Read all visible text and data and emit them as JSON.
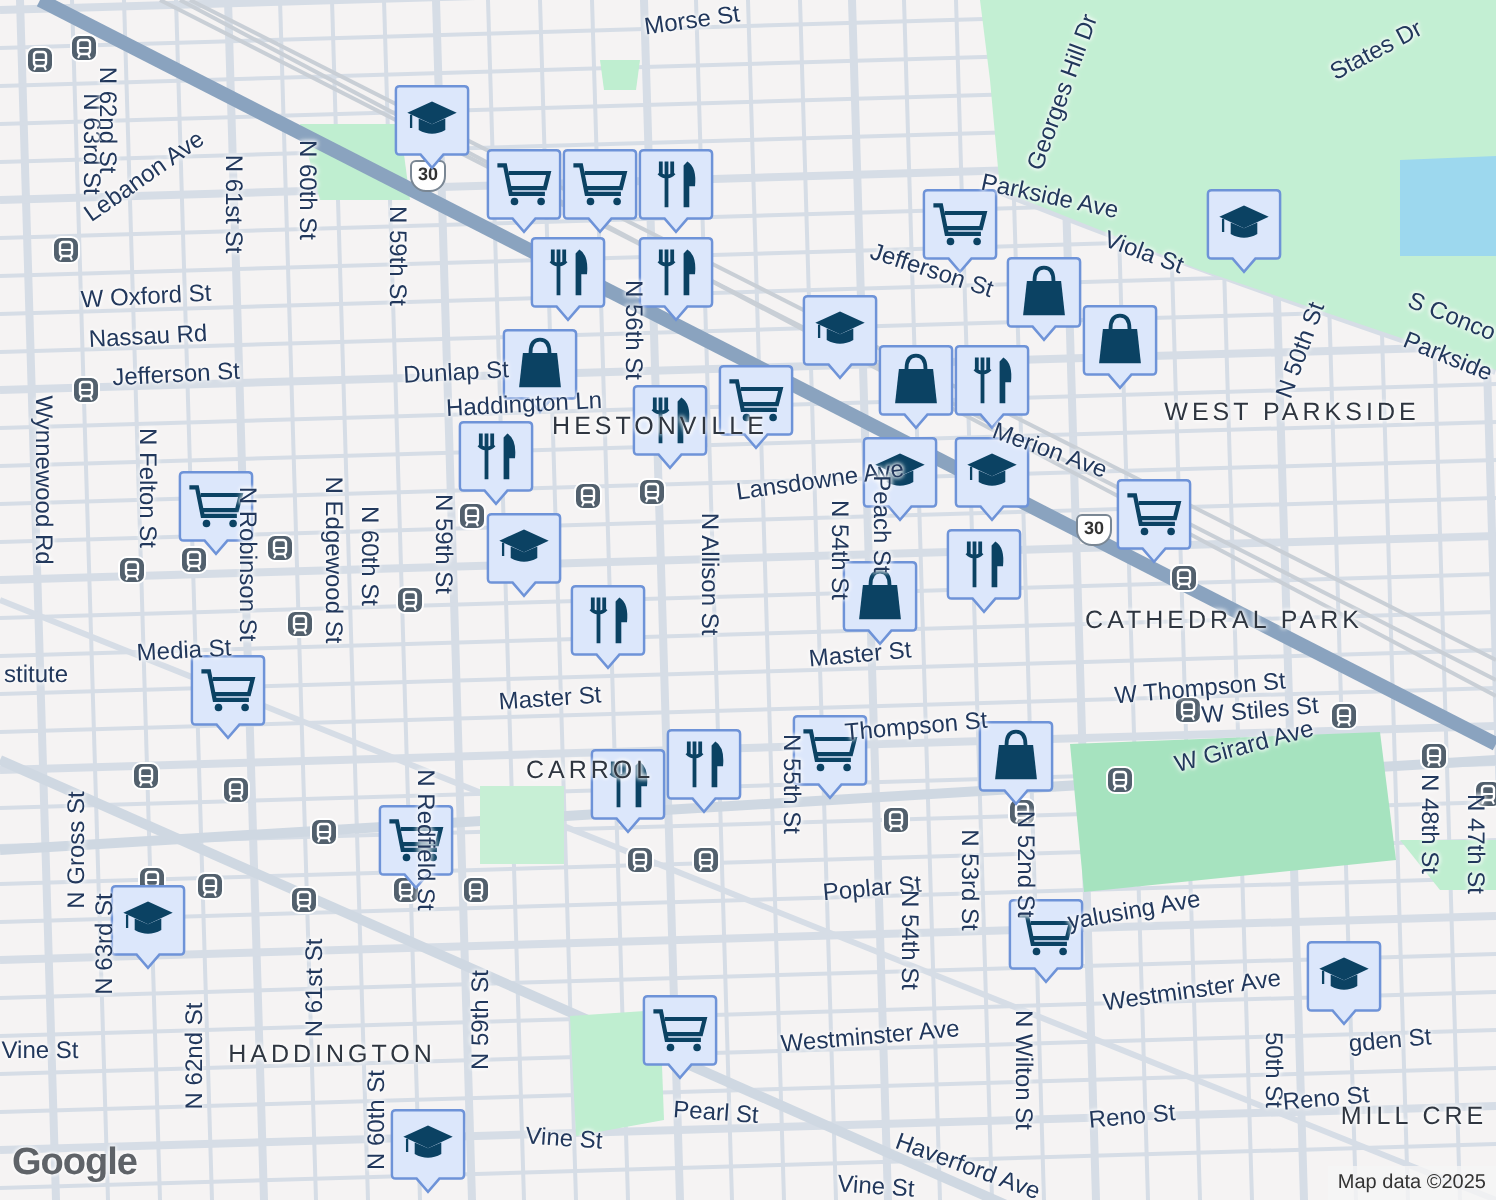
{
  "map": {
    "labels": [
      {
        "text": "Morse St",
        "kind": "street"
      },
      {
        "text": "N 63rd St",
        "kind": "street"
      },
      {
        "text": "N 62nd St",
        "kind": "street"
      },
      {
        "text": "Lebanon Ave",
        "kind": "street"
      },
      {
        "text": "N 61st St",
        "kind": "street"
      },
      {
        "text": "N 60th St",
        "kind": "street"
      },
      {
        "text": "N 59th St",
        "kind": "street"
      },
      {
        "text": "W Oxford St",
        "kind": "street"
      },
      {
        "text": "Nassau Rd",
        "kind": "street"
      },
      {
        "text": "Jefferson St",
        "kind": "street"
      },
      {
        "text": "Wynnewood Rd",
        "kind": "street"
      },
      {
        "text": "N Felton St",
        "kind": "street"
      },
      {
        "text": "Dunlap St",
        "kind": "street"
      },
      {
        "text": "Haddington Ln",
        "kind": "street"
      },
      {
        "text": "N 56th St",
        "kind": "street"
      },
      {
        "text": "Georges Hill Dr",
        "kind": "street"
      },
      {
        "text": "States Dr",
        "kind": "street"
      },
      {
        "text": "Parkside Ave",
        "kind": "street"
      },
      {
        "text": "Jefferson St",
        "kind": "street"
      },
      {
        "text": "Viola St",
        "kind": "street"
      },
      {
        "text": "S Conco",
        "kind": "street"
      },
      {
        "text": "Parkside",
        "kind": "street"
      },
      {
        "text": "N 50th St",
        "kind": "street"
      },
      {
        "text": "WEST PARKSIDE",
        "kind": "district"
      },
      {
        "text": "HESTONVILLE",
        "kind": "district"
      },
      {
        "text": "Lansdowne Ave",
        "kind": "street"
      },
      {
        "text": "Merion Ave",
        "kind": "street"
      },
      {
        "text": "N Allison St",
        "kind": "street"
      },
      {
        "text": "N 54th St",
        "kind": "street"
      },
      {
        "text": "Peach St",
        "kind": "street"
      },
      {
        "text": "N Robinson St",
        "kind": "street"
      },
      {
        "text": "N Edgewood St",
        "kind": "street"
      },
      {
        "text": "N 60th St",
        "kind": "street"
      },
      {
        "text": "N 59th St",
        "kind": "street"
      },
      {
        "text": "CATHEDRAL PARK",
        "kind": "district"
      },
      {
        "text": "stitute",
        "kind": "street"
      },
      {
        "text": "Media St",
        "kind": "street"
      },
      {
        "text": "Master St",
        "kind": "street"
      },
      {
        "text": "Master St",
        "kind": "street"
      },
      {
        "text": "W Thompson St",
        "kind": "street"
      },
      {
        "text": "W Stiles St",
        "kind": "street"
      },
      {
        "text": "Thompson St",
        "kind": "street"
      },
      {
        "text": "W Girard Ave",
        "kind": "street"
      },
      {
        "text": "CARROL",
        "kind": "district"
      },
      {
        "text": "N 55th St",
        "kind": "street"
      },
      {
        "text": "N Gross St",
        "kind": "street"
      },
      {
        "text": "N Redfield St",
        "kind": "street"
      },
      {
        "text": "Poplar St",
        "kind": "street"
      },
      {
        "text": "N 54th St",
        "kind": "street"
      },
      {
        "text": "N 53rd St",
        "kind": "street"
      },
      {
        "text": "N 52nd St",
        "kind": "street"
      },
      {
        "text": "yalusing Ave",
        "kind": "street"
      },
      {
        "text": "N 48th St",
        "kind": "street"
      },
      {
        "text": "N 47th St",
        "kind": "street"
      },
      {
        "text": "N 63rd St",
        "kind": "street"
      },
      {
        "text": "N 61st St",
        "kind": "street"
      },
      {
        "text": "N 62nd St",
        "kind": "street"
      },
      {
        "text": "N 59th St",
        "kind": "street"
      },
      {
        "text": "Vine St",
        "kind": "street"
      },
      {
        "text": "HADDINGTON",
        "kind": "district"
      },
      {
        "text": "Westminster Ave",
        "kind": "street"
      },
      {
        "text": "Westminster Ave",
        "kind": "street"
      },
      {
        "text": "gden St",
        "kind": "street"
      },
      {
        "text": "N Wilton St",
        "kind": "street"
      },
      {
        "text": "50th St",
        "kind": "street"
      },
      {
        "text": "Reno St",
        "kind": "street"
      },
      {
        "text": "Reno St",
        "kind": "street"
      },
      {
        "text": "MILL CRE",
        "kind": "district"
      },
      {
        "text": "N 60th St",
        "kind": "street"
      },
      {
        "text": "Pearl St",
        "kind": "street"
      },
      {
        "text": "Vine St",
        "kind": "street"
      },
      {
        "text": "Haverford Ave",
        "kind": "street"
      },
      {
        "text": "Vine St",
        "kind": "street"
      }
    ],
    "route_shields": [
      "30",
      "30"
    ],
    "markers": [
      {
        "kind": "school"
      },
      {
        "kind": "grocery"
      },
      {
        "kind": "grocery"
      },
      {
        "kind": "restaurant"
      },
      {
        "kind": "restaurant"
      },
      {
        "kind": "restaurant"
      },
      {
        "kind": "shopping"
      },
      {
        "kind": "grocery"
      },
      {
        "kind": "school"
      },
      {
        "kind": "grocery"
      },
      {
        "kind": "restaurant"
      },
      {
        "kind": "shopping"
      },
      {
        "kind": "restaurant"
      },
      {
        "kind": "school"
      },
      {
        "kind": "school"
      },
      {
        "kind": "restaurant"
      },
      {
        "kind": "school"
      },
      {
        "kind": "shopping"
      },
      {
        "kind": "shopping"
      },
      {
        "kind": "school"
      },
      {
        "kind": "grocery"
      },
      {
        "kind": "grocery"
      },
      {
        "kind": "shopping"
      },
      {
        "kind": "restaurant"
      },
      {
        "kind": "restaurant"
      },
      {
        "kind": "grocery"
      },
      {
        "kind": "grocery"
      },
      {
        "kind": "restaurant"
      },
      {
        "kind": "restaurant"
      },
      {
        "kind": "shopping"
      },
      {
        "kind": "grocery"
      },
      {
        "kind": "school"
      },
      {
        "kind": "grocery"
      },
      {
        "kind": "school"
      },
      {
        "kind": "grocery"
      },
      {
        "kind": "school"
      }
    ],
    "logo": "Google",
    "attribution": "Map data ©2025"
  }
}
